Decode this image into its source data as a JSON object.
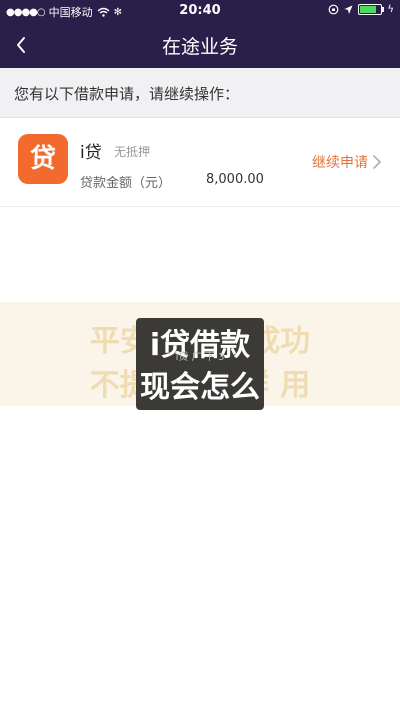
{
  "status_bar": {
    "carrier": "中国移动",
    "time": "20:40"
  },
  "nav": {
    "title": "在途业务",
    "back_icon": "chevron-left-icon"
  },
  "notice": "您有以下借款申请，请继续操作：",
  "loan": {
    "logo_char": "贷",
    "name": "i贷",
    "tag": "无抵押",
    "amount_label": "贷款金额（元）",
    "amount": "8,000.00",
    "action_label": "继续申请",
    "accent_color": "#e5743a",
    "logo_color": "#f26a2e"
  },
  "overlay": {
    "line1": "平安i贷借款成功",
    "line2": "不提现会怎样 用",
    "box_line1": "i贷借款",
    "box_line2": "现会怎么",
    "box_faint": "i贷 广 下 3"
  },
  "colors": {
    "header_bg": "#2a1e4a",
    "subheader_bg": "#f1f1f4"
  }
}
